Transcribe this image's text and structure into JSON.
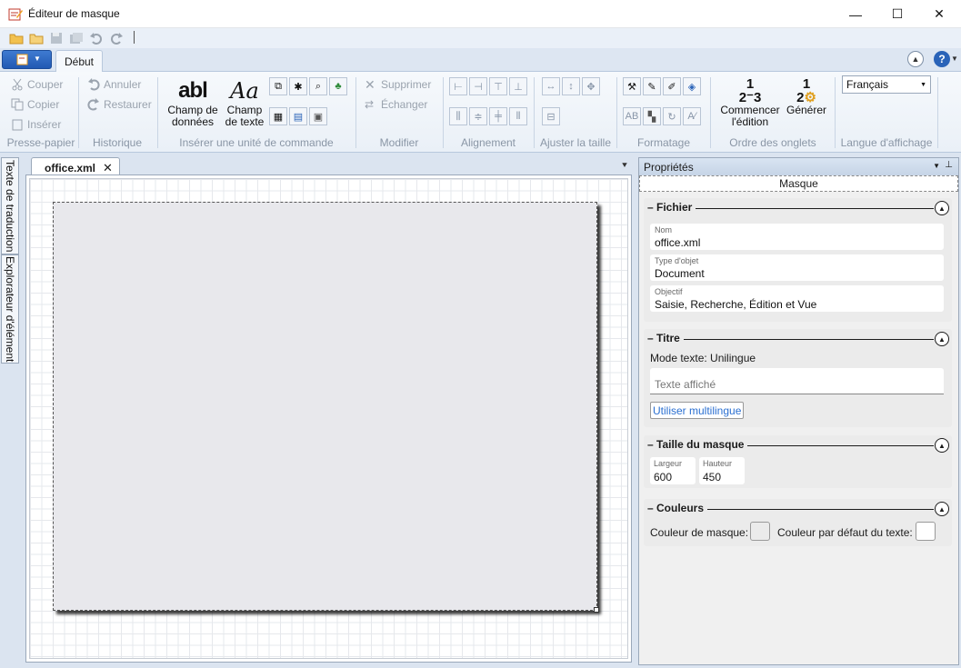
{
  "window": {
    "title": "Éditeur de masque"
  },
  "window_buttons": {
    "minimize": "—",
    "maximize": "☐",
    "close": "✕"
  },
  "ribbon_tabs": {
    "active": "Début"
  },
  "ribbon": {
    "clipboard": {
      "cut": "Couper",
      "copy": "Copier",
      "insert": "Insérer",
      "label": "Presse-papier"
    },
    "history": {
      "undo": "Annuler",
      "redo": "Restaurer",
      "label": "Historique"
    },
    "insert_unit": {
      "data_field_line1": "Champ de",
      "data_field_line2": "données",
      "text_field_line1": "Champ",
      "text_field_line2": "de texte",
      "label": "Insérer une unité de commande"
    },
    "modify": {
      "delete": "Supprimer",
      "swap": "Échanger",
      "label": "Modifier"
    },
    "alignment": {
      "label": "Alignement"
    },
    "fit_size": {
      "label": "Ajuster la taille"
    },
    "formatting": {
      "label": "Formatage"
    },
    "tab_order": {
      "start_edit_line1": "Commencer",
      "start_edit_line2": "l'édition",
      "generate": "Générer",
      "label": "Ordre des onglets"
    },
    "display_language": {
      "selected": "Français",
      "label": "Langue d'affichage"
    }
  },
  "side_tabs": {
    "translation_text": "Texte de traduction",
    "element_explorer": "Explorateur d'élément"
  },
  "document": {
    "tab_name": "office.xml",
    "mask_width": 600,
    "mask_height": 450
  },
  "properties": {
    "title": "Propriétés",
    "object": "Masque",
    "file_section": {
      "heading": "Fichier",
      "name_label": "Nom",
      "name_value": "office.xml",
      "type_label": "Type d'objet",
      "type_value": "Document",
      "purpose_label": "Objectif",
      "purpose_value": "Saisie, Recherche, Édition et Vue"
    },
    "title_section": {
      "heading": "Titre",
      "mode_text": "Mode texte: Unilingue",
      "display_text_placeholder": "Texte affiché",
      "multilingual_button": "Utiliser multilingue"
    },
    "size_section": {
      "heading": "Taille du masque",
      "width_label": "Largeur",
      "width_value": "600",
      "height_label": "Hauteur",
      "height_value": "450"
    },
    "colors_section": {
      "heading": "Couleurs",
      "mask_color_label": "Couleur de masque:",
      "text_color_label": "Couleur par défaut du texte:",
      "mask_color": "#ebebeb",
      "text_color": "#ffffff"
    }
  },
  "colors": {
    "accent": "#2a63b8",
    "ribbon_bg": "#eaf0f7",
    "mask_fill": "#e8e8ec"
  }
}
